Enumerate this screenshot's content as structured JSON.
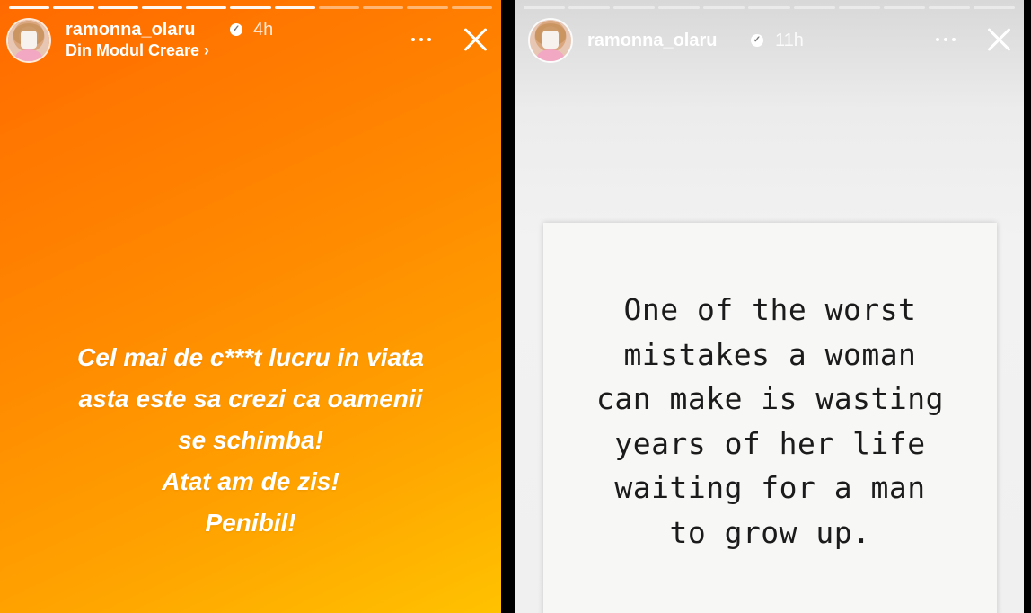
{
  "left_story": {
    "username": "ramonna_olaru",
    "time": "4h",
    "subtitle": "Din Modul Creare",
    "subtitle_chevron": "›",
    "progress": {
      "segments": 11,
      "completed": 7
    },
    "text_lines": [
      "Cel mai de c***t lucru in viata",
      "asta este sa crezi ca oamenii",
      "se schimba!",
      "Atat am de zis!",
      "Penibil!"
    ],
    "colors": {
      "gradient_start": "#ff6a00",
      "gradient_end": "#ffc200"
    }
  },
  "right_story": {
    "username": "ramonna_olaru",
    "time": "11h",
    "progress": {
      "segments": 11,
      "completed": 0
    },
    "quote_lines": [
      "One of the worst",
      "mistakes a woman",
      "can make is wasting",
      "years of her life",
      "waiting for a man",
      "to grow up."
    ]
  },
  "icons": {
    "verified": "verified-badge-icon",
    "more": "more-options-icon",
    "close": "close-icon"
  }
}
